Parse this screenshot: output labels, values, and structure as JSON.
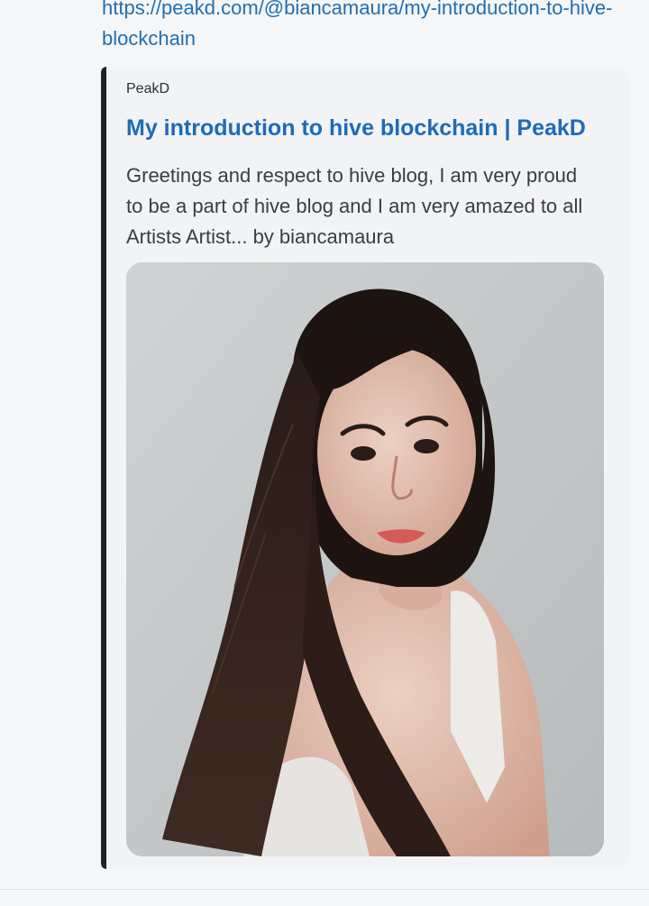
{
  "message": {
    "link_text": "https://peakd.com/@biancamaura/my-introduction-to-hive-blockchain"
  },
  "preview": {
    "site_name": "PeakD",
    "title": "My introduction to hive blockchain | PeakD",
    "description": "Greetings and respect to hive blog, I am very proud to be a part of hive blog and I am very amazed to all Artists Artist... by biancamaura",
    "image_alt": "portrait photo",
    "accent_color": "#1f2326",
    "title_color": "#1e6bb8"
  }
}
